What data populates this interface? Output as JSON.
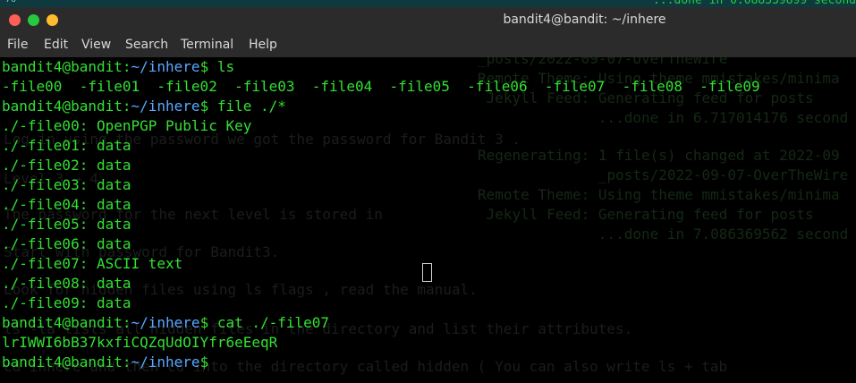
{
  "topstrip": {
    "left_text": "76",
    "right_text": "...done in 0.088339899 second"
  },
  "window": {
    "title": "bandit4@bandit: ~/inhere"
  },
  "menu": [
    "File",
    "Edit",
    "View",
    "Search",
    "Terminal",
    "Help"
  ],
  "prompt": {
    "user": "bandit4@bandit",
    "sep": ":",
    "path": "~/inhere",
    "sym": "$ "
  },
  "commands": {
    "ls": "ls",
    "file": "file ./*",
    "cat": "cat ./-file07"
  },
  "ls_output": "-file00  -file01  -file02  -file03  -file04  -file05  -file06  -file07  -file08  -file09",
  "file_output": [
    "./-file00: OpenPGP Public Key",
    "./-file01: data",
    "./-file02: data",
    "./-file03: data",
    "./-file04: data",
    "./-file05: data",
    "./-file06: data",
    "./-file07: ASCII text",
    "./-file08: data",
    "./-file09: data"
  ],
  "cat_output": "lrIWWI6bB37kxfiCQZqUdOIYfr6eEeqR",
  "background_left": [
    "Log in using the password we got the password for Bandit 3 .",
    "Level 3 → 4",
    "The password for the next level is stored in",
    "Start with password for Bandit3.",
    "Look for hidden files using ls flags , read the manual.",
    "ls -la lists all hidden files in the directory and list their attributes.",
    "cd inhere and then cd into the directory called hidden ( You can also write ls + tab"
  ],
  "background_right": [
    "_posts/2022-09-07-OverTheWire",
    "Remote Theme: Using theme mmistakes/minima",
    " Jekyll Feed: Generating feed for posts",
    "              ...done in 6.717014176 second",
    "Regenerating: 1 file(s) changed at 2022-09",
    "              _posts/2022-09-07-OverTheWire",
    "Remote Theme: Using theme mmistakes/minima",
    " Jekyll Feed: Generating feed for posts",
    "              ...done in 7.086369562 second"
  ]
}
